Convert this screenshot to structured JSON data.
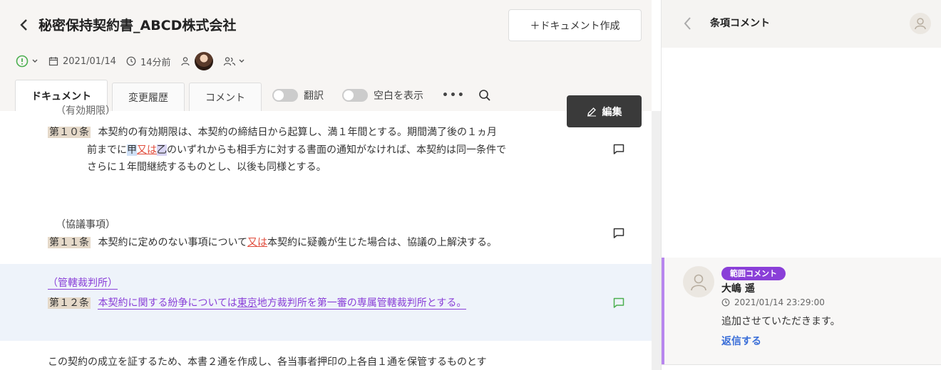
{
  "header": {
    "title": "秘密保持契約書_ABCD株式会社",
    "create_button": "＋ドキュメント作成",
    "date": "2021/01/14",
    "elapsed": "14分前"
  },
  "tabs": [
    {
      "label": "ドキュメント",
      "active": true
    },
    {
      "label": "変更履歴",
      "active": false
    },
    {
      "label": "コメント",
      "active": false
    }
  ],
  "toggles": {
    "translate": "翻訳",
    "show_blank": "空白を表示",
    "more": "•••"
  },
  "edit_button": "編集",
  "doc": {
    "cut_heading": "（有効期限）",
    "art10": {
      "label": "第１０条",
      "line1": "本契約の有効期限は、本契約の締結日から起算し、満１年間とする。期間満了後の１ヵ月",
      "line2_pre": "前までに",
      "line2_a": "甲",
      "line2_or": "又は",
      "line2_b": "乙",
      "line2_post": "のいずれからも相手方に対する書面の通知がなければ、本契約は同一条件で",
      "line3": "さらに１年間継続するものとし、以後も同様とする。"
    },
    "art11": {
      "heading": "（協議事項）",
      "label": "第１１条",
      "pre": "本契約に定めのない事項について",
      "or": "又は",
      "post": "本契約に疑義が生じた場合は、協議の上解決する。"
    },
    "art12": {
      "heading": "（管轄裁判所）",
      "label": "第１２条",
      "pre": "本契約に関する紛争については",
      "place": "東京",
      "post": "地方裁判所を第一審の専属管轄裁判所とする。"
    },
    "closing": "この契約の成立を証するため、本書２通を作成し、各当事者押印の上各自１通を保管するものとす"
  },
  "panel": {
    "title": "条項コメント",
    "comment": {
      "badge": "範囲コメント",
      "author": "大嶋 遥",
      "timestamp": "2021/01/14 23:29:00",
      "text": "追加させていただきます。",
      "reply": "返信する"
    }
  },
  "colors": {
    "accent_purple": "#8a3fd8",
    "link_blue": "#3a6ed8",
    "status_green": "#4caf50",
    "edit_dark": "#3a3a3a"
  }
}
